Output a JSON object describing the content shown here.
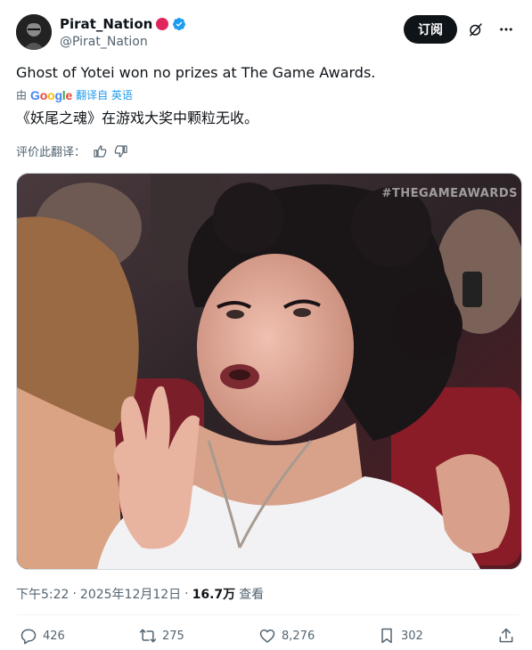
{
  "author": {
    "display_name": "Pirat_Nation",
    "handle": "@Pirat_Nation",
    "verified": true
  },
  "header": {
    "subscribe_label": "订阅",
    "grok_icon": "grok-icon",
    "more_icon": "more-icon"
  },
  "tweet": {
    "text": "Ghost of Yotei won no prizes at The Game Awards.",
    "translate_prefix": "由",
    "translate_provider": "Google",
    "translate_suffix": "翻译自 英语",
    "translated_text": "《妖尾之魂》在游戏大奖中颗粒无收。",
    "rate_label": "评价此翻译："
  },
  "media": {
    "watermark": "#THEGAMEAWARDS"
  },
  "meta": {
    "time": "下午5:22",
    "sep1": "·",
    "date": "2025年12月12日",
    "sep2": "·",
    "views": "16.7万",
    "views_label": "查看"
  },
  "actions": {
    "replies": "426",
    "reposts": "275",
    "likes": "8,276",
    "bookmarks": "302"
  },
  "colors": {
    "accent": "#1d9bf0",
    "text": "#0f1419",
    "secondary": "#536471"
  }
}
